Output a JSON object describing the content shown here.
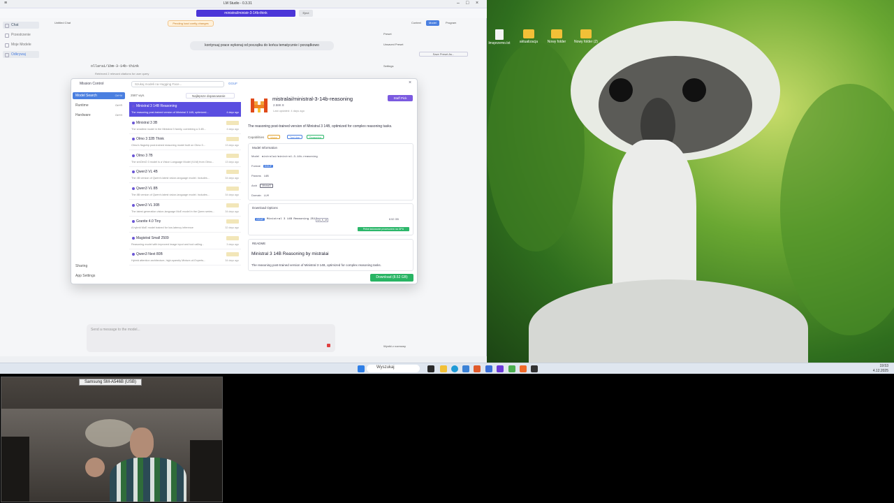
{
  "window": {
    "title": "LM Studio - 0.3.31",
    "loaded_model": "ministral/ministr-3-14b-think",
    "eject_label": "Eject"
  },
  "sidebar": {
    "items": [
      {
        "label": "Chat"
      },
      {
        "label": "Przestrzenie"
      },
      {
        "label": "Moje Modele"
      },
      {
        "label": "Odkrywaj"
      }
    ]
  },
  "chat": {
    "tab_label": "Untitled Chat",
    "banner": "Pending load config changes",
    "user_message": "kontynuuj prace wykonaj od początku do końca tematycznie i porządkowo",
    "assistant_model": "ollarai/ibm-3-14b-think",
    "context_note": "Retrieved 2 relevant citations for user query",
    "composer_placeholder": "Send a message to the model..."
  },
  "right_panel": {
    "preset_label": "Preset",
    "preset_value": "Unsaved Preset",
    "save_preset": "Save Preset As...",
    "settings_label": "Settings",
    "tabs": [
      "Context",
      "Model",
      "Program"
    ],
    "active_tab": 1,
    "bottom_label": "Wyniki z rozmowy"
  },
  "mission_control": {
    "title": "Mission Control",
    "nav": [
      {
        "label": "Model Search",
        "kbd": "Ctrl+M"
      },
      {
        "label": "Runtime",
        "kbd": "Ctrl+R"
      },
      {
        "label": "Hardware",
        "kbd": "Ctrl+H"
      }
    ],
    "nav_bottom": [
      {
        "label": "Sharing"
      },
      {
        "label": "App Settings"
      }
    ],
    "search_placeholder": "Szukaj modeli na Hugging Face...",
    "gguf_label": "GGUF",
    "result_count": "2587 wyn.",
    "sort_label": "Najlepsze dopasowanie",
    "results": [
      {
        "name": "Ministral 3 14B Reasoning",
        "desc": "The reasoning post-trained version of Ministral 3 14B, optimized...",
        "age": "4 days ago",
        "selected": true
      },
      {
        "name": "Ministral 3 3B",
        "desc": "The smallest model in the Ministral 3 family, combining a 3.4B...",
        "age": "4 days ago",
        "selected": false
      },
      {
        "name": "Olmo 3 32B Think",
        "desc": "Olmo's flagship post-trained reasoning model built on Olmo 3...",
        "age": "13 days ago",
        "selected": false
      },
      {
        "name": "Olmo 3 7B",
        "desc": "The smOlmO 3 model is a Vision Language Model (VLM) from Olmo...",
        "age": "13 days ago",
        "selected": false
      },
      {
        "name": "Qwen3 VL 4B",
        "desc": "The 4B version of Qwen's latest vision-language model. Includes...",
        "age": "34 days ago",
        "selected": false
      },
      {
        "name": "Qwen3 VL 8B",
        "desc": "The 8B version of Qwen's latest vision-language model. Includes...",
        "age": "34 days ago",
        "selected": false
      },
      {
        "name": "Qwen3 VL 30B",
        "desc": "The latest generation vision-language MoE model in the Qwen series...",
        "age": "34 days ago",
        "selected": false
      },
      {
        "name": "Granite 4.0 Tiny",
        "desc": "A hybrid MoE model trained for low-latency inference",
        "age": "32 days ago",
        "selected": false
      },
      {
        "name": "Magistral Small 2509",
        "desc": "Reasoning model with improved image input and tool calling...",
        "age": "3 days ago",
        "selected": false
      },
      {
        "name": "Qwen3 Next 80B",
        "desc": "Hybrid attention architecture, high-sparsity Mixture-of-Experts...",
        "age": "34 days ago",
        "selected": false
      }
    ],
    "detail": {
      "title": "mistralai/ministral-3-14b-reasoning",
      "staff_pick": "Staff Pick",
      "stats": "2.58K   8",
      "updated": "Last updated: 4 days ago",
      "description": "The reasoning post-trained version of Ministral 3 14B, optimized for complex reasoning tasks.",
      "capabilities_label": "Capabilities",
      "capabilities": [
        {
          "label": "Vision",
          "color": "#e0a12b"
        },
        {
          "label": "Tool Use",
          "color": "#4a7fe0"
        },
        {
          "label": "Reasoning",
          "color": "#2db76b"
        }
      ],
      "info_header": "Model Information",
      "info": {
        "model_key": "Model",
        "model_val": "mistralai/ministral-3-14b-reasoning",
        "format_key": "Format",
        "format_val": "GGUF",
        "params_key": "Params",
        "params_val": "14B",
        "arch_key": "Arch",
        "arch_val": "Mistral3",
        "domain_key": "Domain",
        "domain_val": "LLM"
      },
      "download_header": "Download Options",
      "download_option": {
        "tag": "GGUF",
        "name": "Ministral 3 14B Reasoning 2512",
        "quant": "Q4_K_M",
        "size": "8.52 GB"
      },
      "gpu_note": "Pełne ładowanie procesorem na GPU",
      "readme_header": "README",
      "readme_title": "Ministral 3 14B Reasoning by mistralai",
      "readme_body": "The reasoning post-trained version of Ministral 3 14B, optimized for complex reasoning tasks.",
      "download_button": "Download   (8.52 GB)"
    }
  },
  "desktop": {
    "icons": [
      {
        "label": "lmsprzemo.txt",
        "type": "doc"
      },
      {
        "label": "aktualizacja",
        "type": "folder"
      },
      {
        "label": "Nowy folder",
        "type": "folder"
      },
      {
        "label": "Nowy folder (2)",
        "type": "folder"
      }
    ]
  },
  "taskbar": {
    "search_placeholder": "Wyszukaj",
    "time": "19:53",
    "date": "4.12.2025"
  },
  "webcam": {
    "device_label": "Samsung SM-A546B (USB)"
  }
}
